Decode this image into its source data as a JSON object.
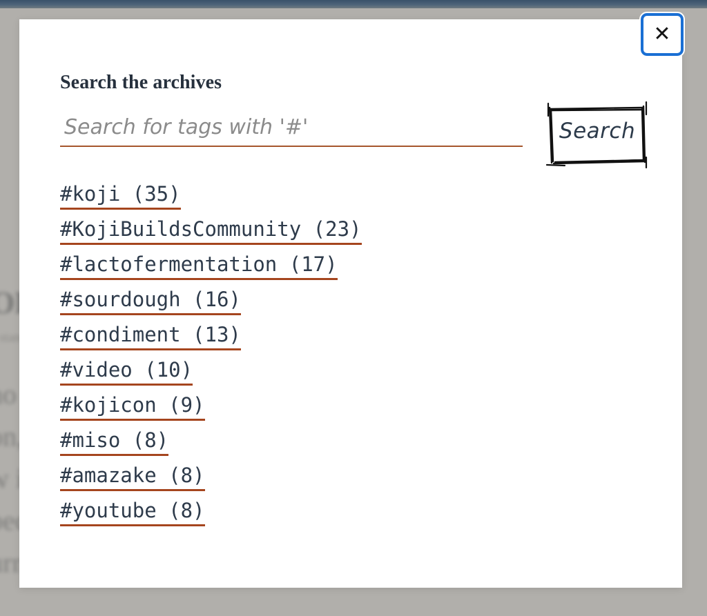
{
  "background": {
    "heading": "OPEN-SOURCE KOJI",
    "subheading": "a standard for sharing ferments",
    "paragraphs": [
      "no one knew exactly what",
      "on, so we kept going and",
      "w it was already too",
      "because someone had",
      "urned the stuff from the can"
    ]
  },
  "modal": {
    "close_label": "✕",
    "title": "Search the archives",
    "search": {
      "placeholder": "Search for tags with '#'",
      "value": "",
      "button_label": "Search"
    },
    "tags": [
      {
        "label": "#koji (35)",
        "name": "koji",
        "count": 35
      },
      {
        "label": "#KojiBuildsCommunity (23)",
        "name": "KojiBuildsCommunity",
        "count": 23
      },
      {
        "label": "#lactofermentation (17)",
        "name": "lactofermentation",
        "count": 17
      },
      {
        "label": "#sourdough (16)",
        "name": "sourdough",
        "count": 16
      },
      {
        "label": "#condiment (13)",
        "name": "condiment",
        "count": 13
      },
      {
        "label": "#video (10)",
        "name": "video",
        "count": 10
      },
      {
        "label": "#kojicon (9)",
        "name": "kojicon",
        "count": 9
      },
      {
        "label": "#miso (8)",
        "name": "miso",
        "count": 8
      },
      {
        "label": "#amazake (8)",
        "name": "amazake",
        "count": 8
      },
      {
        "label": "#youtube (8)",
        "name": "youtube",
        "count": 8
      }
    ]
  },
  "colors": {
    "topbar": "#3a526a",
    "scrim": "#96938d",
    "accent_rust": "#a5451e",
    "input_underline": "#a5552c",
    "focus_ring": "#1a6fd4",
    "text_navy": "#26303d"
  }
}
